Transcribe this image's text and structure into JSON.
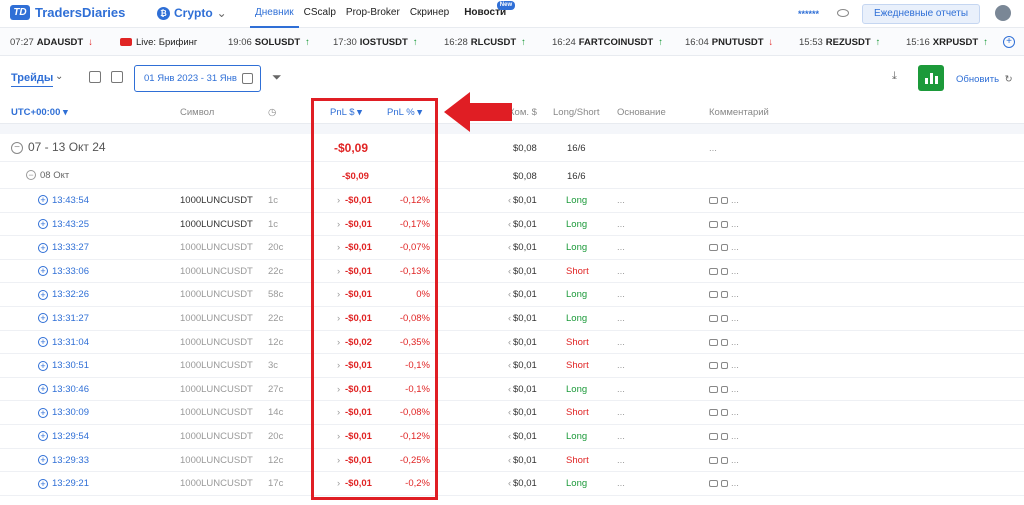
{
  "brand": {
    "name": "TradersDiaries",
    "mark": "TD"
  },
  "market": {
    "label": "Crypto",
    "icon": "bitcoin-icon"
  },
  "nav": [
    {
      "label": "Дневник",
      "active": true
    },
    {
      "label": "CScalp"
    },
    {
      "label": "Prop-Broker"
    },
    {
      "label": "Скринер"
    },
    {
      "label": "Новости",
      "badge": "New"
    }
  ],
  "account": {
    "masked": "******",
    "reports_label": "Ежедневные отчеты"
  },
  "ticker": [
    {
      "time": "07:27",
      "symbol": "ADAUSDT",
      "dir": "down"
    },
    {
      "live": true,
      "symbol": "Live: Брифинг"
    },
    {
      "time": "19:06",
      "symbol": "SOLUSDT",
      "dir": "up"
    },
    {
      "time": "17:30",
      "symbol": "IOSTUSDT",
      "dir": "up"
    },
    {
      "time": "16:28",
      "symbol": "RLCUSDT",
      "dir": "up"
    },
    {
      "time": "16:24",
      "symbol": "FARTCOINUSDT",
      "dir": "up"
    },
    {
      "time": "16:04",
      "symbol": "PNUTUSDT",
      "dir": "down"
    },
    {
      "time": "15:53",
      "symbol": "REZUSDT",
      "dir": "up"
    },
    {
      "time": "15:16",
      "symbol": "XRPUSDT",
      "dir": "up"
    }
  ],
  "toolbar": {
    "tab": "Трейды",
    "date_range": "01 Янв 2023 - 31 Янв",
    "refresh": "Обновить"
  },
  "columns": {
    "time": "UTC+00:00",
    "symbol": "Символ",
    "pnl_usd": "PnL $",
    "pnl_pct": "PnL %",
    "commission": "Ком. $",
    "long_short": "Long/Short",
    "reason": "Основание",
    "comment": "Комментарий"
  },
  "group": {
    "label": "07 - 13 Окт 24",
    "pnl": "-$0,09",
    "commission": "$0,08",
    "ls": "16/6",
    "comment": "..."
  },
  "subgroup": {
    "label": "08 Окт",
    "pnl": "-$0,09",
    "commission": "$0,08",
    "ls": "16/6"
  },
  "trades": [
    {
      "time": "13:43:54",
      "symbol": "1000LUNCUSDT",
      "dur": "1с",
      "pnl": "-$0,01",
      "pct": "-0,12%",
      "com": "$0,01",
      "side": "Long"
    },
    {
      "time": "13:43:25",
      "symbol": "1000LUNCUSDT",
      "dur": "1с",
      "pnl": "-$0,01",
      "pct": "-0,17%",
      "com": "$0,01",
      "side": "Long"
    },
    {
      "time": "13:33:27",
      "symbol": "1000LUNCUSDT",
      "dur": "20с",
      "pnl": "-$0,01",
      "pct": "-0,07%",
      "com": "$0,01",
      "side": "Long"
    },
    {
      "time": "13:33:06",
      "symbol": "1000LUNCUSDT",
      "dur": "22с",
      "pnl": "-$0,01",
      "pct": "-0,13%",
      "com": "$0,01",
      "side": "Short"
    },
    {
      "time": "13:32:26",
      "symbol": "1000LUNCUSDT",
      "dur": "58с",
      "pnl": "-$0,01",
      "pct": "0%",
      "com": "$0,01",
      "side": "Long"
    },
    {
      "time": "13:31:27",
      "symbol": "1000LUNCUSDT",
      "dur": "22с",
      "pnl": "-$0,01",
      "pct": "-0,08%",
      "com": "$0,01",
      "side": "Long"
    },
    {
      "time": "13:31:04",
      "symbol": "1000LUNCUSDT",
      "dur": "12с",
      "pnl": "-$0,02",
      "pct": "-0,35%",
      "com": "$0,01",
      "side": "Short"
    },
    {
      "time": "13:30:51",
      "symbol": "1000LUNCUSDT",
      "dur": "3с",
      "pnl": "-$0,01",
      "pct": "-0,1%",
      "com": "$0,01",
      "side": "Short"
    },
    {
      "time": "13:30:46",
      "symbol": "1000LUNCUSDT",
      "dur": "27с",
      "pnl": "-$0,01",
      "pct": "-0,1%",
      "com": "$0,01",
      "side": "Long"
    },
    {
      "time": "13:30:09",
      "symbol": "1000LUNCUSDT",
      "dur": "14с",
      "pnl": "-$0,01",
      "pct": "-0,08%",
      "com": "$0,01",
      "side": "Short"
    },
    {
      "time": "13:29:54",
      "symbol": "1000LUNCUSDT",
      "dur": "20с",
      "pnl": "-$0,01",
      "pct": "-0,12%",
      "com": "$0,01",
      "side": "Long"
    },
    {
      "time": "13:29:33",
      "symbol": "1000LUNCUSDT",
      "dur": "12с",
      "pnl": "-$0,01",
      "pct": "-0,25%",
      "com": "$0,01",
      "side": "Short"
    },
    {
      "time": "13:29:21",
      "symbol": "1000LUNCUSDT",
      "dur": "17с",
      "pnl": "-$0,01",
      "pct": "-0,2%",
      "com": "$0,01",
      "side": "Long"
    }
  ],
  "colors": {
    "accent": "#2f6fd6",
    "positive": "#1c9a3a",
    "negative": "#e02424",
    "highlight": "#e01e24"
  }
}
